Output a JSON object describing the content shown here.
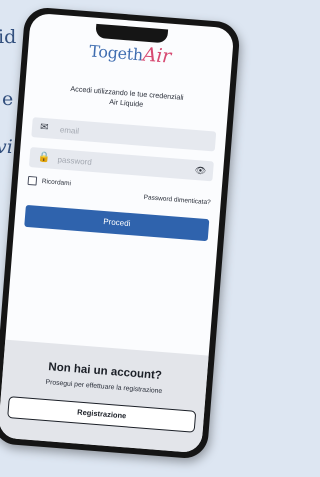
{
  "background_words": [
    "id",
    "e",
    "vi"
  ],
  "logo": {
    "part1": "Togeth",
    "part2": "Air"
  },
  "subtitle": {
    "line1": "Accedi utilizzando le tue credenziali",
    "line2": "Air Liquide"
  },
  "email": {
    "placeholder": "email"
  },
  "password": {
    "placeholder": "password"
  },
  "remember_label": "Ricordami",
  "forgot_label": "Password dimenticata?",
  "proceed_label": "Procedi",
  "no_account": {
    "title": "Non hai un account?",
    "subtitle": "Prosegui per effettuare la registrazione",
    "button": "Registrazione"
  },
  "colors": {
    "primary": "#2f63ad",
    "accent": "#d74a72",
    "frame": "#151515"
  }
}
